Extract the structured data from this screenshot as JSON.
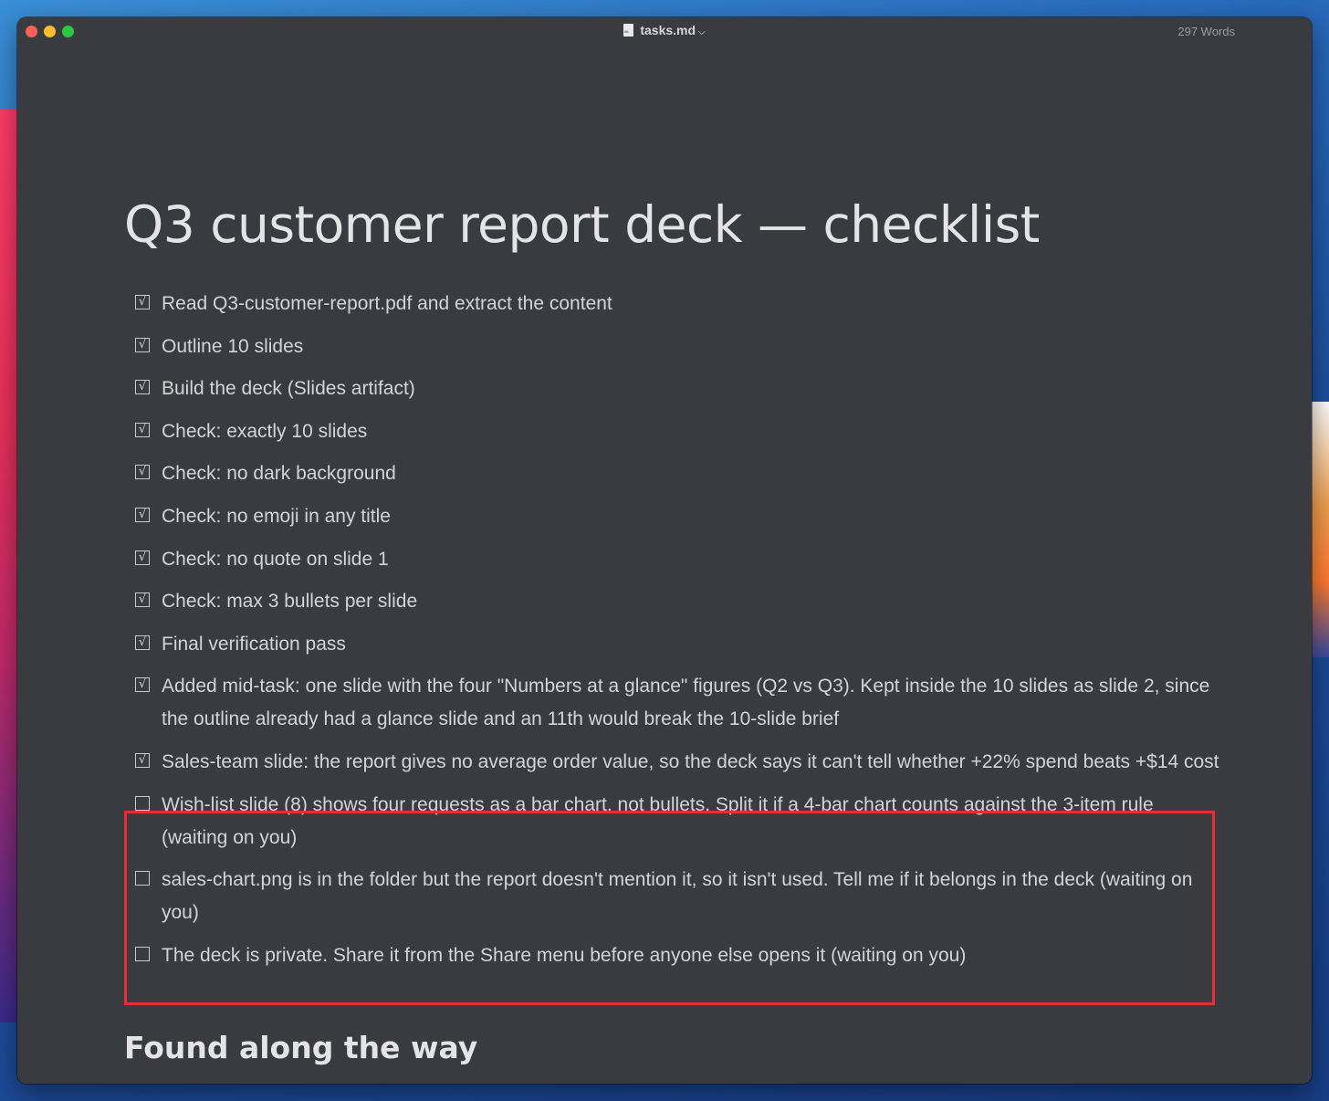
{
  "window": {
    "file_name": "tasks.md",
    "word_count": "297 Words",
    "file_icon": "markdown-file-icon"
  },
  "document": {
    "title": "Q3 customer report deck — checklist",
    "tasks": [
      {
        "checked": true,
        "mark": "√",
        "text": "Read Q3-customer-report.pdf and extract the content"
      },
      {
        "checked": true,
        "mark": "√",
        "text": "Outline 10 slides"
      },
      {
        "checked": true,
        "mark": "√",
        "text": "Build the deck (Slides artifact)"
      },
      {
        "checked": true,
        "mark": "√",
        "text": "Check: exactly 10 slides"
      },
      {
        "checked": true,
        "mark": "√",
        "text": "Check: no dark background"
      },
      {
        "checked": true,
        "mark": "√",
        "text": "Check: no emoji in any title"
      },
      {
        "checked": true,
        "mark": "√",
        "text": "Check: no quote on slide 1"
      },
      {
        "checked": true,
        "mark": "√",
        "text": "Check: max 3 bullets per slide"
      },
      {
        "checked": true,
        "mark": "√",
        "text": "Final verification pass"
      },
      {
        "checked": true,
        "mark": "√",
        "text": "Added mid-task: one slide with the four \"Numbers at a glance\" figures (Q2 vs Q3). Kept inside the 10 slides as slide 2, since the outline already had a glance slide and an 11th would break the 10-slide brief"
      },
      {
        "checked": true,
        "mark": "√",
        "text": "Sales-team slide: the report gives no average order value, so the deck says it can't tell whether +22% spend beats +$14 cost"
      },
      {
        "checked": false,
        "mark": "",
        "text": "Wish-list slide (8) shows four requests as a bar chart, not bullets. Split it if a 4-bar chart counts against the 3-item rule (waiting on you)"
      },
      {
        "checked": false,
        "mark": "",
        "text": "sales-chart.png is in the folder but the report doesn't mention it, so it isn't used. Tell me if it belongs in the deck (waiting on you)"
      },
      {
        "checked": false,
        "mark": "",
        "text": "The deck is private. Share it from the Share menu before anyone else opens it (waiting on you)"
      }
    ],
    "section_heading": "Found along the way"
  },
  "colors": {
    "editor_bg": "#3a3b41",
    "highlight_border": "#e0303a",
    "text": "#d3d4d7"
  }
}
